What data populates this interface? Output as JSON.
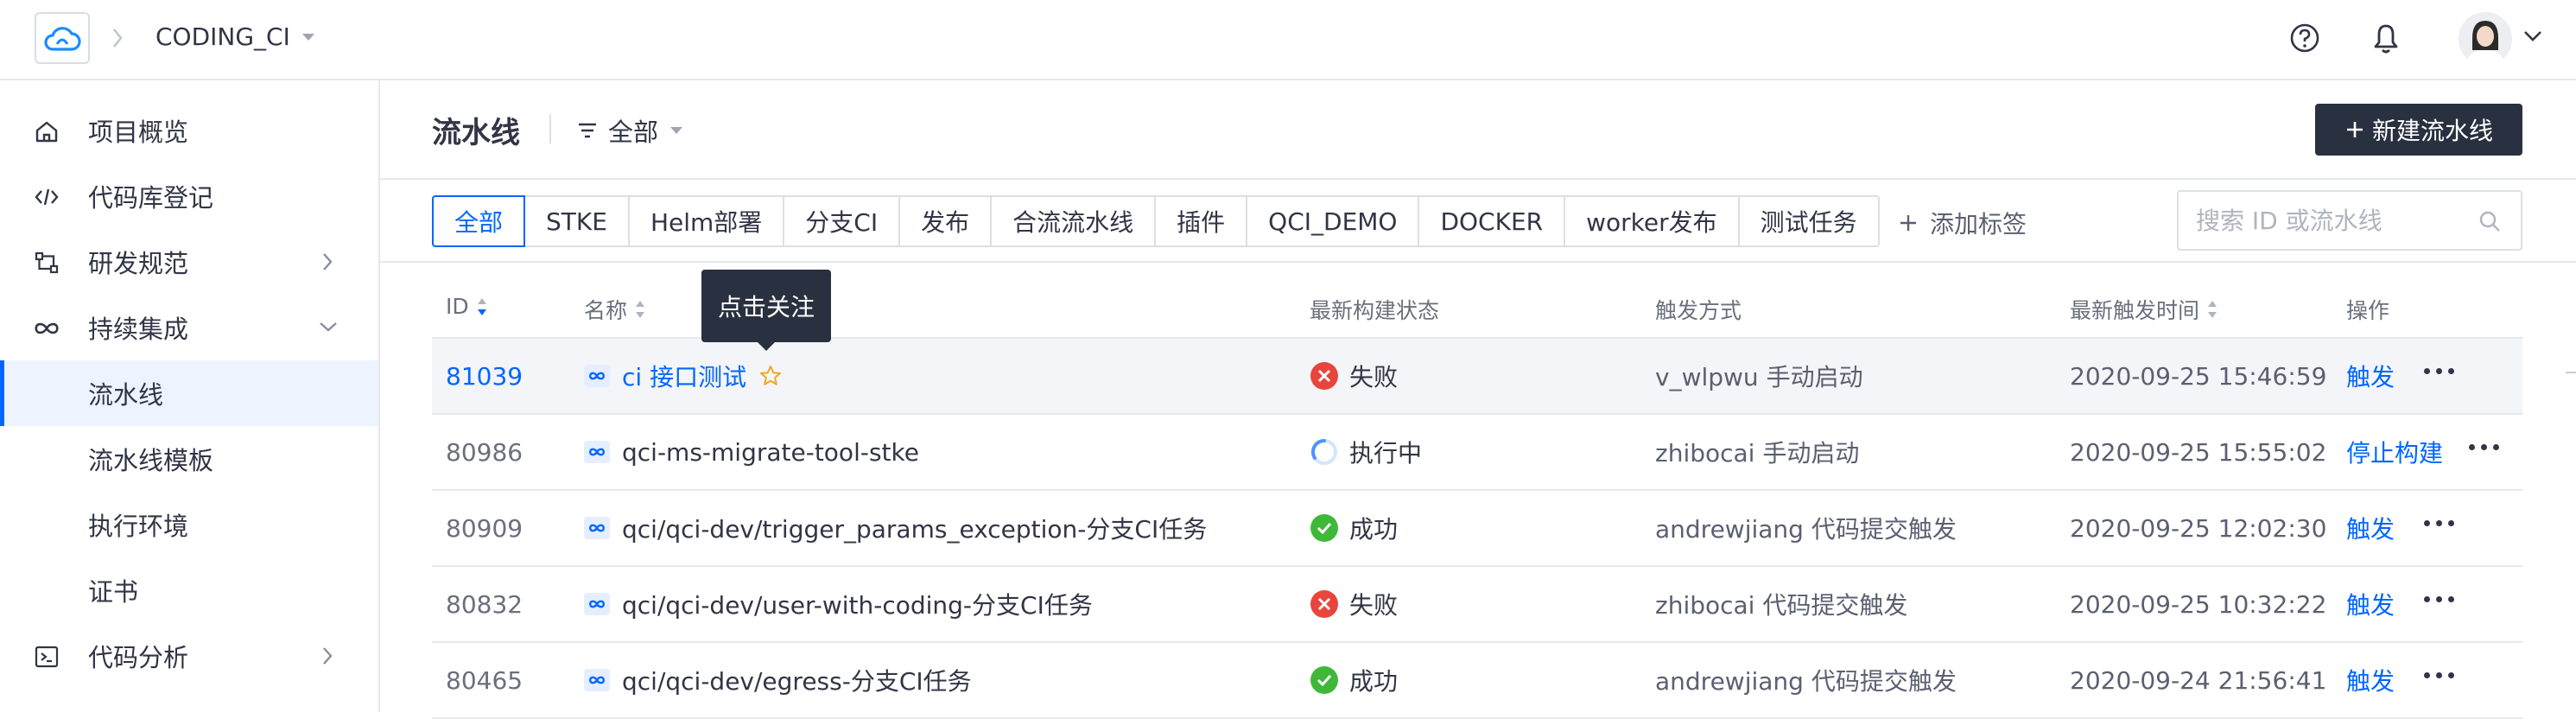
{
  "header": {
    "project": "CODING_CI"
  },
  "sidebar": {
    "items": [
      {
        "label": "项目概览",
        "icon": "home-icon"
      },
      {
        "label": "代码库登记",
        "icon": "code-icon"
      },
      {
        "label": "研发规范",
        "icon": "flow-icon"
      },
      {
        "label": "持续集成",
        "icon": "infinity-icon"
      },
      {
        "label": "流水线"
      },
      {
        "label": "流水线模板"
      },
      {
        "label": "执行环境"
      },
      {
        "label": "证书"
      },
      {
        "label": "代码分析",
        "icon": "terminal-icon"
      }
    ]
  },
  "main": {
    "title": "流水线",
    "filter_label": "全部",
    "new_button": "新建流水线",
    "tabs": [
      "全部",
      "STKE",
      "Helm部署",
      "分支CI",
      "发布",
      "合流流水线",
      "插件",
      "QCI_DEMO",
      "DOCKER",
      "worker发布",
      "测试任务"
    ],
    "add_tag": "添加标签",
    "search_placeholder": "搜索 ID 或流水线",
    "tooltip": "点击关注"
  },
  "table": {
    "headers": {
      "id": "ID",
      "name": "名称",
      "status": "最新构建状态",
      "trigger": "触发方式",
      "time": "最新触发时间",
      "ops": "操作"
    },
    "rows": [
      {
        "id": "81039",
        "name": "ci 接口测试",
        "status": "失败",
        "status_type": "fail",
        "trigger": "v_wlpwu 手动启动",
        "time": "2020-09-25 15:46:59",
        "op": "触发"
      },
      {
        "id": "80986",
        "name": "qci-ms-migrate-tool-stke",
        "status": "执行中",
        "status_type": "running",
        "trigger": "zhibocai 手动启动",
        "time": "2020-09-25 15:55:02",
        "op": "停止构建"
      },
      {
        "id": "80909",
        "name": "qci/qci-dev/trigger_params_exception-分支CI任务",
        "status": "成功",
        "status_type": "success",
        "trigger": "andrewjiang 代码提交触发",
        "time": "2020-09-25 12:02:30",
        "op": "触发"
      },
      {
        "id": "80832",
        "name": "qci/qci-dev/user-with-coding-分支CI任务",
        "status": "失败",
        "status_type": "fail",
        "trigger": "zhibocai 代码提交触发",
        "time": "2020-09-25 10:32:22",
        "op": "触发"
      },
      {
        "id": "80465",
        "name": "qci/qci-dev/egress-分支CI任务",
        "status": "成功",
        "status_type": "success",
        "trigger": "andrewjiang 代码提交触发",
        "time": "2020-09-24 21:56:41",
        "op": "触发"
      }
    ]
  },
  "colors": {
    "accent": "#0066ff",
    "fail": "#e8453c",
    "success": "#3fb83a",
    "dark": "#29303f"
  }
}
